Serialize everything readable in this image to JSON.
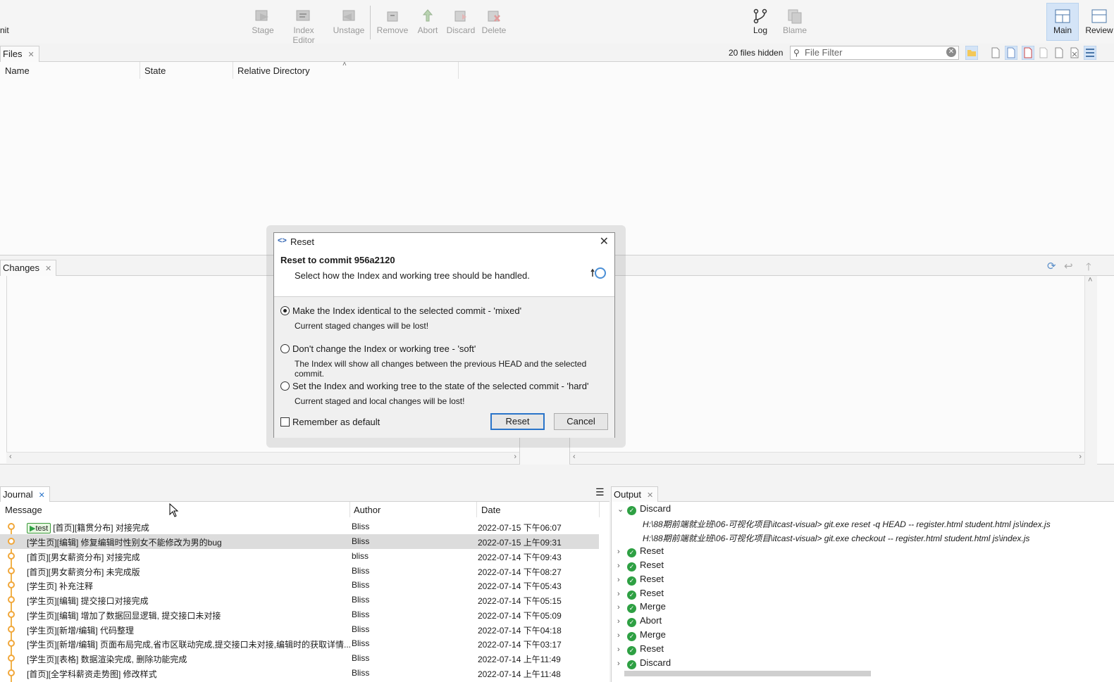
{
  "toolbar": {
    "left_clip": "nit",
    "buttons": [
      "Stage",
      "Index Editor",
      "Unstage",
      "Remove",
      "Abort",
      "Discard",
      "Delete"
    ],
    "log": "Log",
    "blame": "Blame",
    "main": "Main",
    "review": "Review"
  },
  "files": {
    "tab": "Files",
    "hidden": "20 files hidden",
    "filter_placeholder": "File Filter",
    "columns": [
      "Name",
      "State",
      "Relative Directory"
    ]
  },
  "changes": {
    "tab": "Changes"
  },
  "journal": {
    "tab": "Journal",
    "columns": [
      "Message",
      "Author",
      "Date"
    ],
    "branch_tag": "test",
    "rows": [
      {
        "message": "[首页][籍贯分布] 对接完成",
        "author": "Bliss",
        "date": "2022-07-15 下午06:07"
      },
      {
        "message": "[学生页][编辑] 修复编辑时性别女不能修改为男的bug",
        "author": "Bliss",
        "date": "2022-07-15 上午09:31"
      },
      {
        "message": "[首页][男女薪资分布] 对接完成",
        "author": "bliss",
        "date": "2022-07-14 下午09:43"
      },
      {
        "message": "[首页][男女薪资分布] 未完成版",
        "author": "Bliss",
        "date": "2022-07-14 下午08:27"
      },
      {
        "message": "[学生页] 补充注释",
        "author": "Bliss",
        "date": "2022-07-14 下午05:43"
      },
      {
        "message": "[学生页][编辑] 提交接口对接完成",
        "author": "Bliss",
        "date": "2022-07-14 下午05:15"
      },
      {
        "message": "[学生页][编辑] 增加了数据回显逻辑, 提交接口未对接",
        "author": "Bliss",
        "date": "2022-07-14 下午05:09"
      },
      {
        "message": "[学生页][新增/编辑] 代码整理",
        "author": "Bliss",
        "date": "2022-07-14 下午04:18"
      },
      {
        "message": "[学生页][新增/编辑] 页面布局完成,省市区联动完成,提交接口未对接,编辑时的获取详情...",
        "author": "Bliss",
        "date": "2022-07-14 下午03:17"
      },
      {
        "message": "[学生页][表格] 数据渲染完成, 删除功能完成",
        "author": "Bliss",
        "date": "2022-07-14 上午11:49"
      },
      {
        "message": "[首页][全学科薪资走势图] 修改样式",
        "author": "Bliss",
        "date": "2022-07-14 上午11:48"
      }
    ]
  },
  "output": {
    "tab": "Output",
    "expanded": {
      "label": "Discard",
      "commands": [
        "H:\\88期前端就业班\\06-可视化项目\\itcast-visual> git.exe reset -q HEAD -- register.html student.html js\\index.js",
        "H:\\88期前端就业班\\06-可视化项目\\itcast-visual> git.exe checkout -- register.html student.html js\\index.js"
      ]
    },
    "items": [
      "Reset",
      "Reset",
      "Reset",
      "Reset",
      "Merge",
      "Abort",
      "Merge",
      "Reset",
      "Discard"
    ]
  },
  "dialog": {
    "title": "Reset",
    "heading": "Reset to commit 956a2120",
    "subtitle": "Select how the Index and working tree should be handled.",
    "options": [
      {
        "label": "Make the Index identical to the selected commit - 'mixed'",
        "desc": "Current staged changes will be lost!",
        "selected": true
      },
      {
        "label": "Don't change the Index or working tree - 'soft'",
        "desc": "The Index will show all changes between the previous HEAD and the selected commit.",
        "selected": false
      },
      {
        "label": "Set the Index and working tree to the state of the selected commit - 'hard'",
        "desc": "Current staged and local changes will be lost!",
        "selected": false
      }
    ],
    "remember": "Remember as default",
    "ok": "Reset",
    "cancel": "Cancel"
  },
  "colors": {
    "accent": "#2a74c9",
    "graph": "#f1a73a",
    "success": "#2ea043",
    "selected_row": "#dcdcdc"
  }
}
